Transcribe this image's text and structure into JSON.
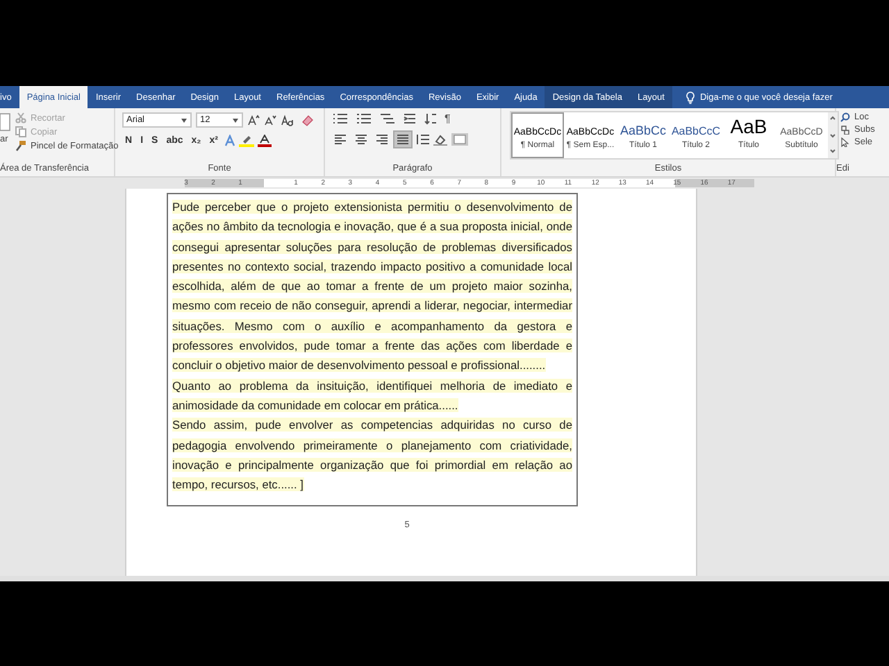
{
  "ribbon_tabs": [
    {
      "label": "ivo",
      "selected": false,
      "contextual": false
    },
    {
      "label": "Página Inicial",
      "selected": true,
      "contextual": false
    },
    {
      "label": "Inserir",
      "selected": false,
      "contextual": false
    },
    {
      "label": "Desenhar",
      "selected": false,
      "contextual": false
    },
    {
      "label": "Design",
      "selected": false,
      "contextual": false
    },
    {
      "label": "Layout",
      "selected": false,
      "contextual": false
    },
    {
      "label": "Referências",
      "selected": false,
      "contextual": false
    },
    {
      "label": "Correspondências",
      "selected": false,
      "contextual": false
    },
    {
      "label": "Revisão",
      "selected": false,
      "contextual": false
    },
    {
      "label": "Exibir",
      "selected": false,
      "contextual": false
    },
    {
      "label": "Ajuda",
      "selected": false,
      "contextual": false
    },
    {
      "label": "Design da Tabela",
      "selected": false,
      "contextual": true
    },
    {
      "label": "Layout",
      "selected": false,
      "contextual": true
    }
  ],
  "tell_me": {
    "placeholder": "Diga-me o que você deseja fazer"
  },
  "clipboard": {
    "paste_label": "ar",
    "cut": "Recortar",
    "copy": "Copiar",
    "format_painter": "Pincel de Formatação",
    "group_label": "Área de Transferência"
  },
  "font": {
    "family": "Arial",
    "size": "12",
    "format_buttons": [
      "N",
      "I",
      "S",
      "abc",
      "x₂",
      "x²"
    ],
    "group_label": "Fonte"
  },
  "paragraph": {
    "pilcrow": "¶",
    "alignments": [
      {
        "kind": "left",
        "selected": false
      },
      {
        "kind": "center",
        "selected": false
      },
      {
        "kind": "right",
        "selected": false
      },
      {
        "kind": "justify",
        "selected": true
      }
    ],
    "group_label": "Parágrafo"
  },
  "styles": {
    "items": [
      {
        "preview": "AaBbCcDc",
        "name": "¶ Normal",
        "kind": "normal",
        "selected": true
      },
      {
        "preview": "AaBbCcDc",
        "name": "¶ Sem Esp...",
        "kind": "normal",
        "selected": false
      },
      {
        "preview": "AaBbCc",
        "name": "Título 1",
        "kind": "heading1",
        "selected": false
      },
      {
        "preview": "AaBbCcC",
        "name": "Título 2",
        "kind": "heading2",
        "selected": false
      },
      {
        "preview": "AaB",
        "name": "Título",
        "kind": "title",
        "selected": false
      },
      {
        "preview": "AaBbCcD",
        "name": "Subtítulo",
        "kind": "subtitle",
        "selected": false
      }
    ],
    "group_label": "Estilos"
  },
  "editing": {
    "find": "Loc",
    "replace": "Subs",
    "select": "Sele",
    "group_label": "Edi"
  },
  "ruler": {
    "left_labels": [
      "3",
      "2",
      "1"
    ],
    "right_labels": [
      "1",
      "2",
      "3",
      "4",
      "5",
      "6",
      "7",
      "8",
      "9",
      "10",
      "11",
      "12",
      "13",
      "14",
      "15",
      "16",
      "17"
    ]
  },
  "document": {
    "paragraphs": [
      {
        "text": "Pude perceber que o projeto extensionista permitiu o desenvolvimento de ações no âmbito da tecnologia e inovação, que é a sua proposta inicial, onde consegui apresentar soluções para resolução de problemas diversificados presentes no contexto social, trazendo impacto positivo a comunidade local escolhida, além de que ao tomar a frente de um projeto maior sozinha, mesmo com receio de não conseguir, aprendi a liderar, negociar, intermediar situações. Mesmo com o auxílio e acompanhamento da gestora e professores envolvidos, pude tomar a frente das ações com liberdade e concluir o objetivo maior de desenvolvimento pessoal e profissional........",
        "highlighted": true
      },
      {
        "text": "Quanto ao problema da insituição, identifiquei melhoria de imediato e animosidade da comunidade em colocar em prática......",
        "highlighted": true
      },
      {
        "text": "Sendo assim, pude envolver as competencias adquiridas no curso de pedagogia envolvendo primeiramente o planejamento com criatividade, inovação e principalmente organização que foi primordial em relação ao tempo, recursos, etc...... ]",
        "highlighted": true
      }
    ],
    "page_number": "5"
  }
}
